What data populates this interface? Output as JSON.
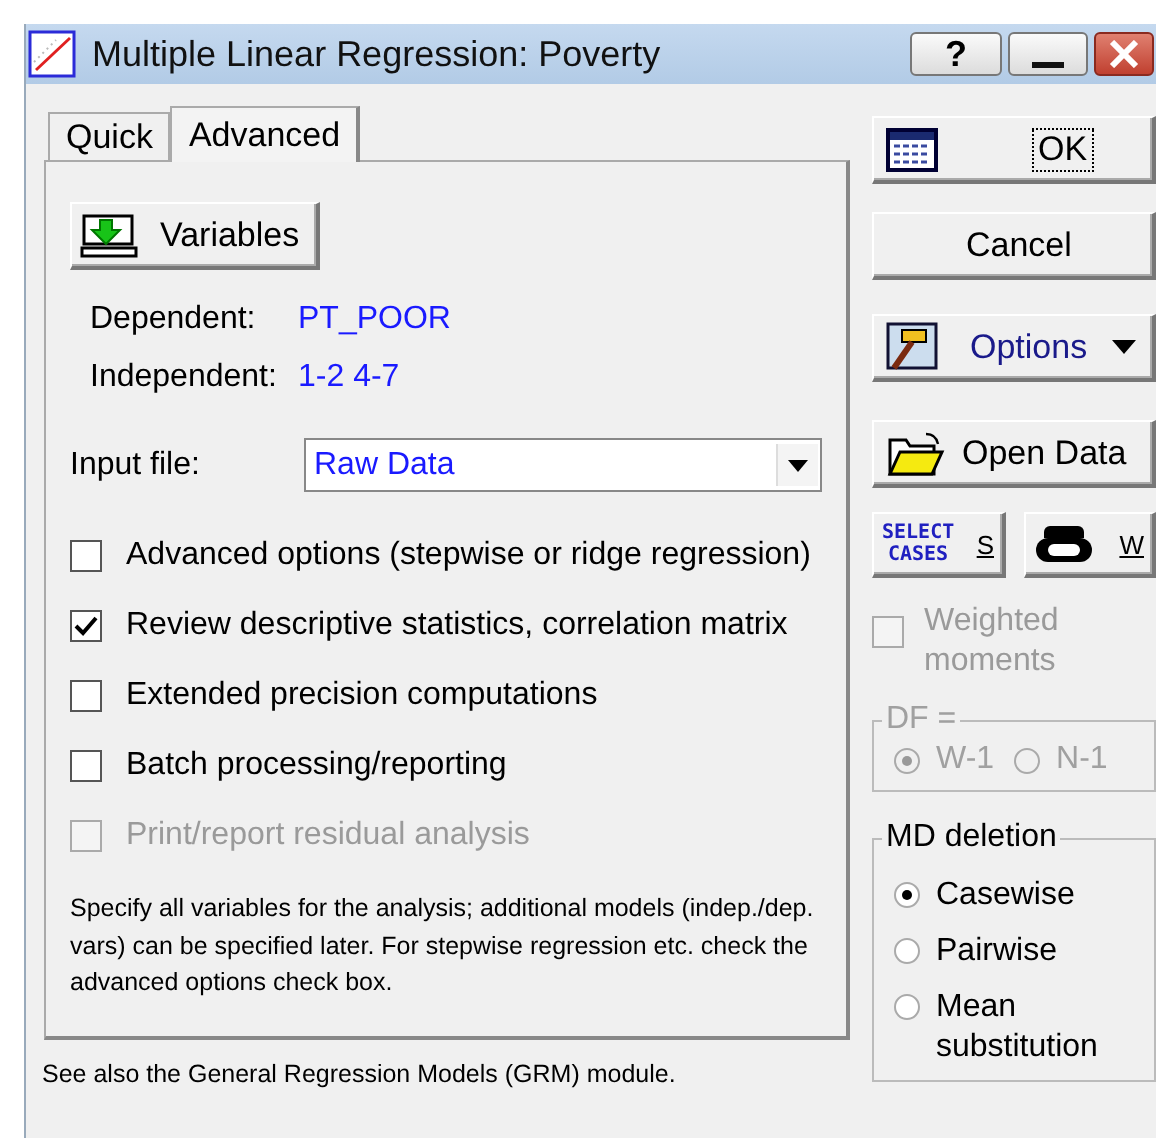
{
  "window": {
    "title": "Multiple Linear Regression: Poverty",
    "help": "?"
  },
  "tabs": [
    {
      "label": "Quick",
      "selected": false
    },
    {
      "label": "Advanced",
      "selected": true
    }
  ],
  "variables_button": "Variables",
  "fields": [
    {
      "label": "Dependent:",
      "value": "PT_POOR"
    },
    {
      "label": "Independent:",
      "value": "1-2 4-7"
    }
  ],
  "input_file": {
    "label": "Input file:",
    "value": "Raw Data"
  },
  "options": [
    {
      "label": "Advanced options (stepwise or ridge regression)",
      "checked": false,
      "disabled": false
    },
    {
      "label": "Review descriptive statistics, correlation matrix",
      "checked": true,
      "disabled": false
    },
    {
      "label": "Extended precision computations",
      "checked": false,
      "disabled": false
    },
    {
      "label": "Batch processing/reporting",
      "checked": false,
      "disabled": false
    },
    {
      "label": "Print/report residual analysis",
      "checked": false,
      "disabled": true
    }
  ],
  "note": "Specify all variables for the analysis; additional models (indep./dep. vars) can be specified later.  For stepwise regression etc. check the advanced options check box.",
  "footer": "See also the General Regression Models (GRM) module.",
  "side_buttons": [
    {
      "kind": "ok",
      "label": "OK"
    },
    {
      "kind": "cancel",
      "label": "Cancel"
    },
    {
      "kind": "options",
      "label": "Options"
    },
    {
      "kind": "open",
      "label": "Open Data"
    }
  ],
  "select_cases": {
    "caption": "SELECT CASES",
    "key": "S"
  },
  "weight": {
    "key": "W"
  },
  "weighted_moments": {
    "label": "Weighted moments",
    "checked": false,
    "disabled": true
  },
  "df": {
    "title": "DF =",
    "disabled": true,
    "options": [
      {
        "label": "W-1",
        "selected": true
      },
      {
        "label": "N-1",
        "selected": false
      }
    ]
  },
  "md_deletion": {
    "title": "MD deletion",
    "options": [
      {
        "label": "Casewise",
        "selected": true
      },
      {
        "label": "Pairwise",
        "selected": false
      },
      {
        "label": "Mean substitution",
        "selected": false
      }
    ]
  }
}
